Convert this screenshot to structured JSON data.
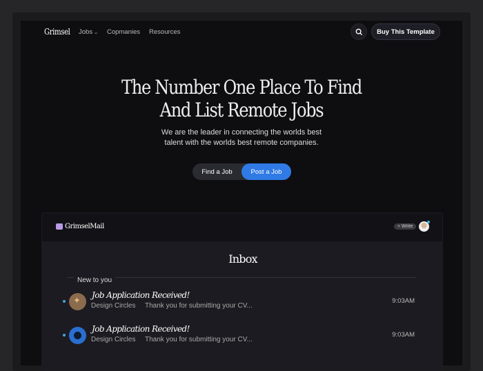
{
  "nav": {
    "logo": "Grimsel",
    "links": [
      "Jobs",
      "Copmanies",
      "Resources"
    ],
    "buy": "Buy This Template"
  },
  "hero": {
    "title_line1": "The Number One Place To Find",
    "title_line2": "And List Remote Jobs",
    "sub_line1": "We are the leader in connecting the worlds best",
    "sub_line2": "talent with the worlds best remote companies.",
    "find": "Find a Job",
    "post": "Post a Job"
  },
  "mail": {
    "logo": "GrimselMail",
    "write": "+ Write",
    "title": "Inbox",
    "section": "New to you",
    "rows": [
      {
        "subject": "Job Application Received!",
        "from": "Design Circles",
        "snippet": "Thank you for submitting your CV...",
        "time": "9:03AM"
      },
      {
        "subject": "Job Application Received!",
        "from": "Design Circles",
        "snippet": "Thank you for submitting your CV...",
        "time": "9:03AM"
      }
    ]
  }
}
